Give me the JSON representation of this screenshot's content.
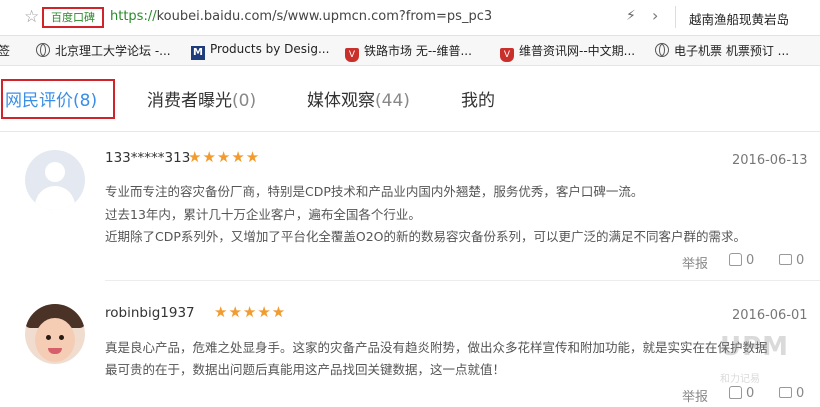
{
  "address_bar": {
    "site_tag": "百度口碑",
    "url_scheme": "https://",
    "url_rest": "koubei.baidu.com/s/www.upmcn.com?from=ps_pc3",
    "search_query": "越南渔船现黄岩岛"
  },
  "bookmarks": [
    {
      "label": "签",
      "icon": "bookmark-icon"
    },
    {
      "label": "北京理工大学论坛 -...",
      "icon": "globe-icon"
    },
    {
      "label": "Products by Desig...",
      "icon": "m-logo-icon"
    },
    {
      "label": "铁路市场 无--维普...",
      "icon": "shield-icon"
    },
    {
      "label": "维普资讯网--中文期...",
      "icon": "shield-icon"
    },
    {
      "label": "电子机票 机票预订 ...",
      "icon": "globe-icon"
    }
  ],
  "tabs": [
    {
      "label": "网民评价",
      "count": "(8)"
    },
    {
      "label": "消费者曝光",
      "count": "(0)"
    },
    {
      "label": "媒体观察",
      "count": "(44)"
    },
    {
      "label": "我的",
      "count": ""
    }
  ],
  "reviews": [
    {
      "user": "133*****313",
      "stars": "★★★★★",
      "date": "2016-06-13",
      "lines": [
        "专业而专注的容灾备份厂商，特别是CDP技术和产品业内国内外翘楚，服务优秀，客户口碑一流。",
        "过去13年内，累计几十万企业客户，遍布全国各个行业。",
        "近期除了CDP系列外，又增加了平台化全覆盖O2O的新的数易容灾备份系列，可以更广泛的满足不同客户群的需求。"
      ],
      "report": "举报",
      "likes": "0",
      "comments": "0"
    },
    {
      "user": "robinbig1937",
      "stars": "★★★★★",
      "date": "2016-06-01",
      "lines": [
        "真是良心产品，危难之处显身手。这家的灾备产品没有趋炎附势，做出众多花样宣传和附加功能，就是实实在在保护数据",
        "最可贵的在于，数据出问题后真能用这产品找回关键数据，这一点就值！"
      ],
      "report": "举报",
      "likes": "0",
      "comments": "0"
    }
  ],
  "watermark": {
    "text": "UPM",
    "sub": "和力记易"
  },
  "colors": {
    "accent": "#3a8ee6",
    "highlight_box": "#d0232a",
    "star": "#f29b2e",
    "url_green": "#2a8a2a"
  }
}
